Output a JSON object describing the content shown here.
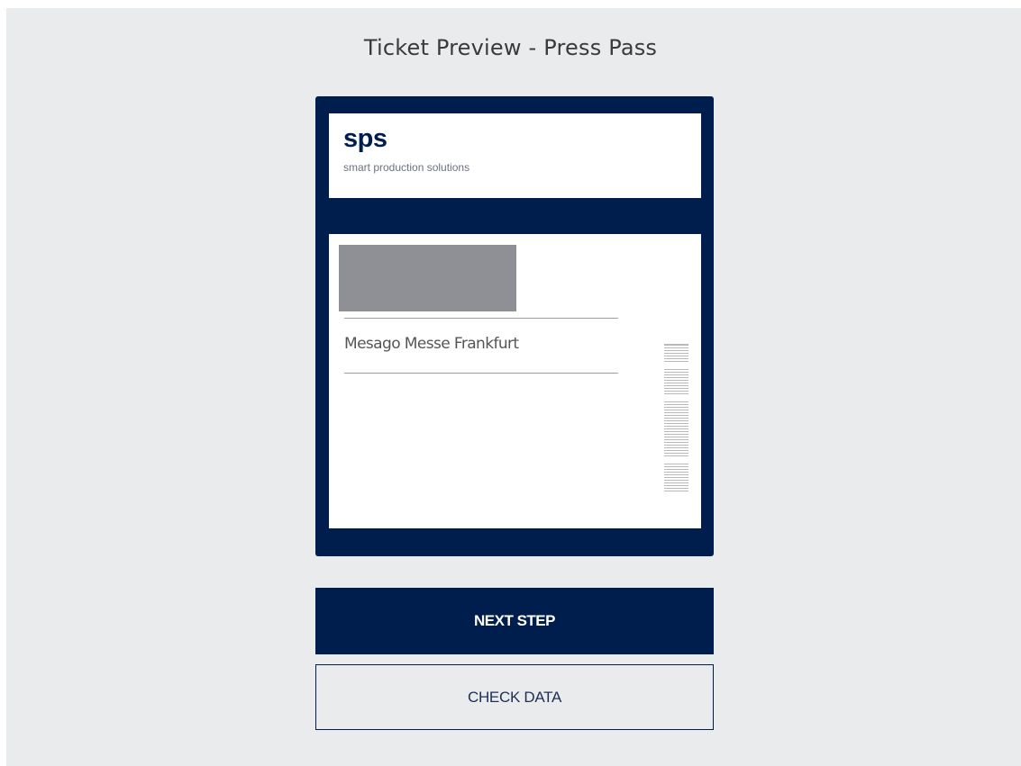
{
  "page": {
    "title": "Ticket Preview - Press Pass"
  },
  "ticket": {
    "logo": {
      "wordmark": "sps",
      "tagline": "smart production solutions"
    },
    "photo": "photo-placeholder",
    "company": "Mesago Messe Frankfurt",
    "barcode": "barcode-icon"
  },
  "actions": {
    "next_step_label": "NEXT STEP",
    "check_data_label": "CHECK DATA"
  },
  "colors": {
    "brand_navy": "#001e4d",
    "background": "#eaebed",
    "placeholder_gray": "#8f9095"
  }
}
